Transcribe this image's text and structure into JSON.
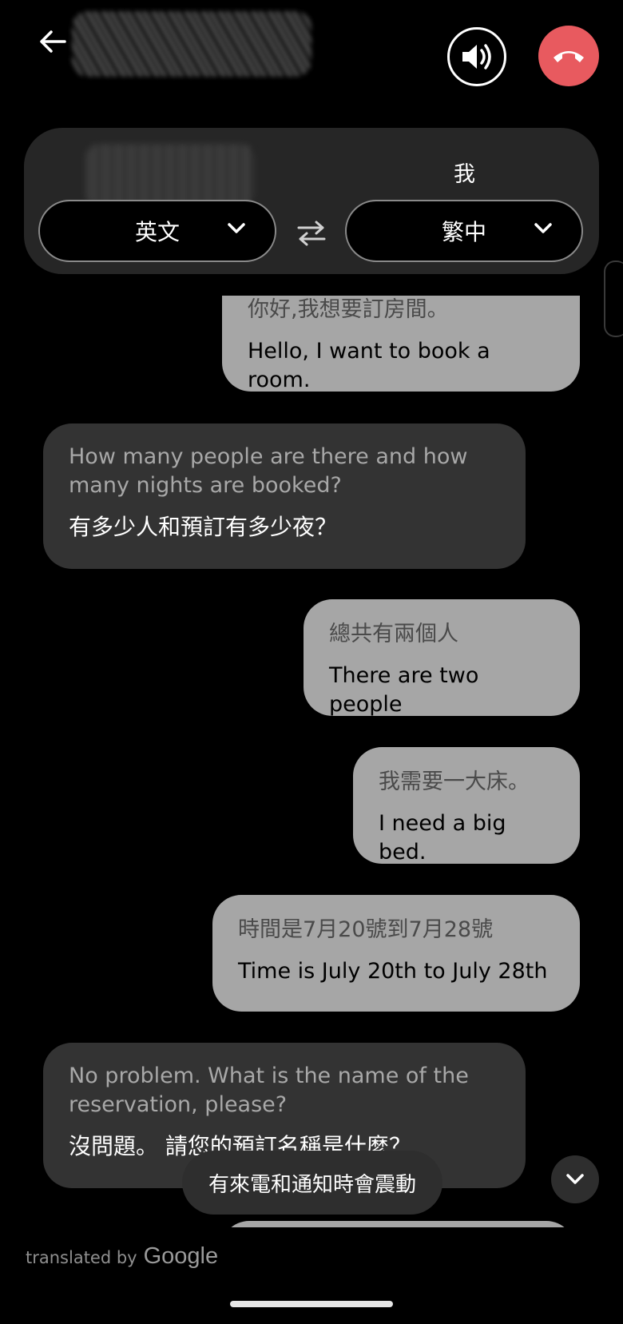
{
  "header": {
    "back_icon": "arrow-left-icon",
    "speaker_icon": "speaker-icon",
    "hangup_icon": "phone-hangup-icon",
    "hangup_color": "#e85a5f"
  },
  "languages": {
    "me_label": "我",
    "left_language": "英文",
    "right_language": "繁中",
    "swap_icon": "swap-icon"
  },
  "messages": [
    {
      "side": "out",
      "original": "你好,我想要訂房間。",
      "translation": "Hello, I want to book a room."
    },
    {
      "side": "in",
      "original": "How many people are there and how many nights are booked?",
      "translation": "有多少人和預訂有多少夜？"
    },
    {
      "side": "out",
      "original": "總共有兩個人",
      "translation": "There are two people"
    },
    {
      "side": "out",
      "original": "我需要一大床。",
      "translation": "I need a big bed."
    },
    {
      "side": "out",
      "original": "時間是7月20號到7月28號",
      "translation": "Time is July 20th to July 28th"
    },
    {
      "side": "in",
      "original": "No problem. What is the name of the reservation, please?",
      "translation": "沒問題。 請您的預訂名稱是什麼？"
    }
  ],
  "toast": "有來電和通知時會震動",
  "footer": {
    "translated_by": "translated by",
    "brand": "Google"
  },
  "colors": {
    "outgoing_bubble": "#a6a6a6",
    "incoming_bubble": "#333333",
    "panel": "#262626"
  }
}
